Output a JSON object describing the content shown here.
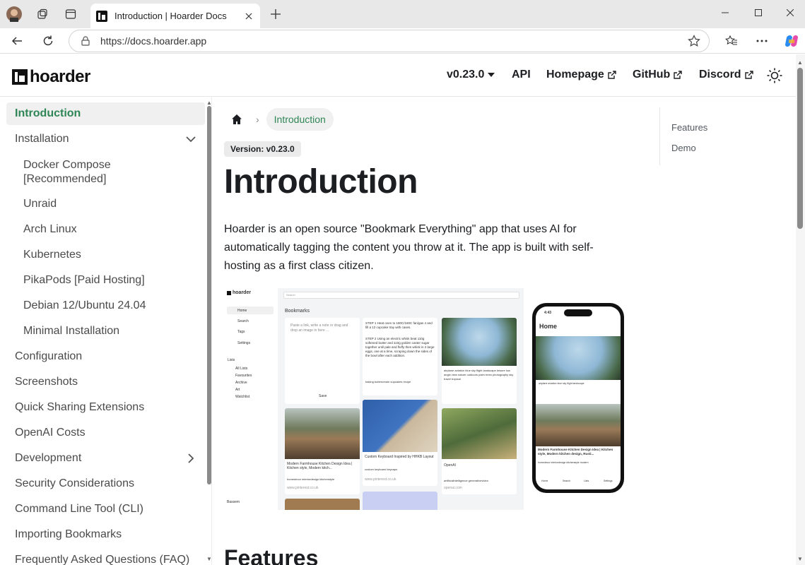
{
  "browser": {
    "tab_title": "Introduction | Hoarder Docs",
    "url": "https://docs.hoarder.app"
  },
  "navbar": {
    "brand": "hoarder",
    "version": "v0.23.0",
    "api": "API",
    "homepage": "Homepage",
    "github": "GitHub",
    "discord": "Discord"
  },
  "sidebar": {
    "items": [
      {
        "label": "Introduction"
      },
      {
        "label": "Installation"
      },
      {
        "label": "Docker Compose"
      },
      {
        "label": "[Recommended]"
      },
      {
        "label": "Unraid"
      },
      {
        "label": "Arch Linux"
      },
      {
        "label": "Kubernetes"
      },
      {
        "label": "PikaPods [Paid Hosting]"
      },
      {
        "label": "Debian 12/Ubuntu 24.04"
      },
      {
        "label": "Minimal Installation"
      },
      {
        "label": "Configuration"
      },
      {
        "label": "Screenshots"
      },
      {
        "label": "Quick Sharing Extensions"
      },
      {
        "label": "OpenAI Costs"
      },
      {
        "label": "Development"
      },
      {
        "label": "Security Considerations"
      },
      {
        "label": "Command Line Tool (CLI)"
      },
      {
        "label": "Importing Bookmarks"
      },
      {
        "label": "Frequently Asked Questions (FAQ)"
      }
    ]
  },
  "content": {
    "breadcrumb_current": "Introduction",
    "version_badge": "Version: v0.23.0",
    "title": "Introduction",
    "intro": "Hoarder is an open source \"Bookmark Everything\" app that uses AI for automatically tagging the content you throw at it. The app is built with self-hosting as a first class citizen.",
    "features_heading": "Features"
  },
  "toc": {
    "items": [
      "Features",
      "Demo"
    ]
  },
  "screenshot": {
    "brand": "hoarder",
    "nav": [
      "Home",
      "Search",
      "Tags",
      "Settings"
    ],
    "lists_label": "Lists",
    "lists": [
      "All Lists",
      "Favourites",
      "Archive",
      "Art",
      "Watchlist"
    ],
    "user": "Bassem",
    "search_placeholder": "Search",
    "heading": "Bookmarks",
    "note_placeholder": "Paste a link, write a note or drag and drop an image in here ...",
    "save": "Save",
    "recipe": "STEP 1 Heat oven to 180C/160C fan/gas 4 and fill a 12 cupcake tray with cases.",
    "recipe2": "STEP 2 Using an electric whisk beat 110g softened butter and 110g golden caster sugar together until pale and fluffy then whisk in 2 large eggs, one at a time, scraping down the sides of the bowl after each addition.",
    "recipe_tags": "baking   buttercream   cupcakes   recipe",
    "palm_tags": "airplane  aviation  blue sky  flight  landscape  leisure  low angle view  nature  outdoors  palm trees  photography  sky  travel  tropical",
    "kitchen_title": "Modern Farmhouse Kitchen Design Idea | Kitchen style, Modern kitch...",
    "kitchen_tags": "homedecor   interiordesign   kitchenstyle",
    "kitchen_url": "www.pinterest.co.uk",
    "keyboard_title": "Custom Keyboard Inspired by HHKB Layout",
    "keyboard_tags": "custom   keyboard   keycaps",
    "keyboard_url": "www.pinterest.co.uk",
    "openai_title": "OpenAI",
    "openai_tags": "artificialintelligence   generativevideo",
    "openai_url": "openai.com",
    "phone_time": "4:43",
    "phone_title": "Home",
    "phone_palm_tags": "airplane   aviation   blue sky   flight   landscape",
    "phone_kitchen_title": "Modern Farmhouse Kitchen Design Idea | Kitchen style, Modern kitchen design, Rusti...",
    "phone_kitchen_tags": "homedecor   interiordesign   kitchenstyle   modern",
    "phone_tabs": [
      "Home",
      "Search",
      "Lists",
      "Settings"
    ]
  },
  "colors": {
    "accent": "#2e8555",
    "active_bg": "#f0f0f0"
  }
}
